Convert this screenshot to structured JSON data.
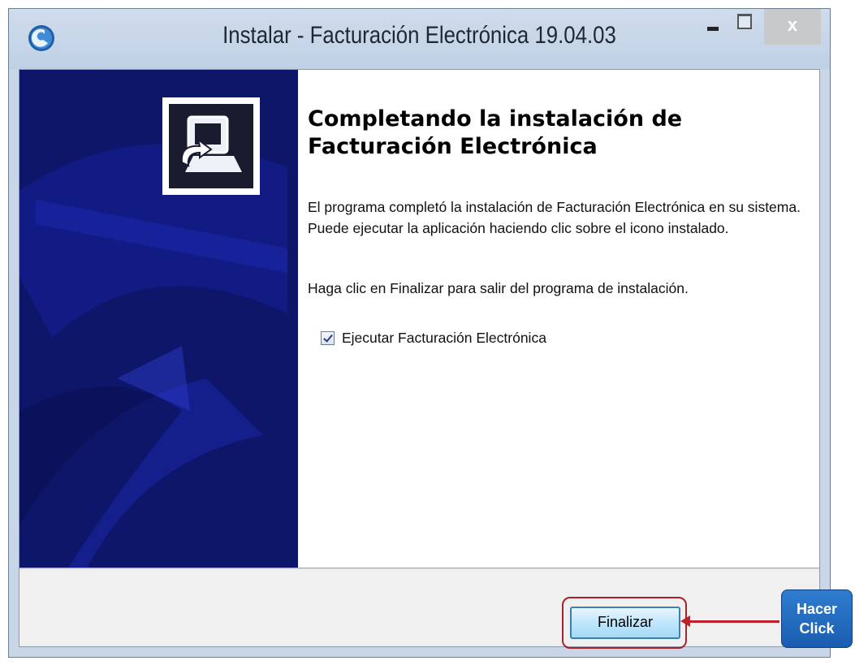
{
  "window": {
    "title": "Instalar - Facturación Electrónica 19.04.03",
    "close_label": "x"
  },
  "main": {
    "heading": "Completando la instalación de Facturación Electrónica",
    "description": "El programa completó la instalación de Facturación Electrónica en su sistema. Puede ejecutar la aplicación haciendo clic sobre el icono instalado.",
    "instruction": "Haga clic en Finalizar para salir del programa de instalación.",
    "checkbox_label": "Ejecutar Facturación Electrónica",
    "checkbox_checked": true
  },
  "footer": {
    "finish_label": "Finalizar"
  },
  "annotation": {
    "callout_line1": "Hacer",
    "callout_line2": "Click",
    "highlight_color": "#a3232e",
    "arrow_color": "#c0202a",
    "callout_color": "#1f66bf"
  },
  "colors": {
    "side_panel": "#0e1669",
    "titlebar": "#c9d6e8"
  }
}
